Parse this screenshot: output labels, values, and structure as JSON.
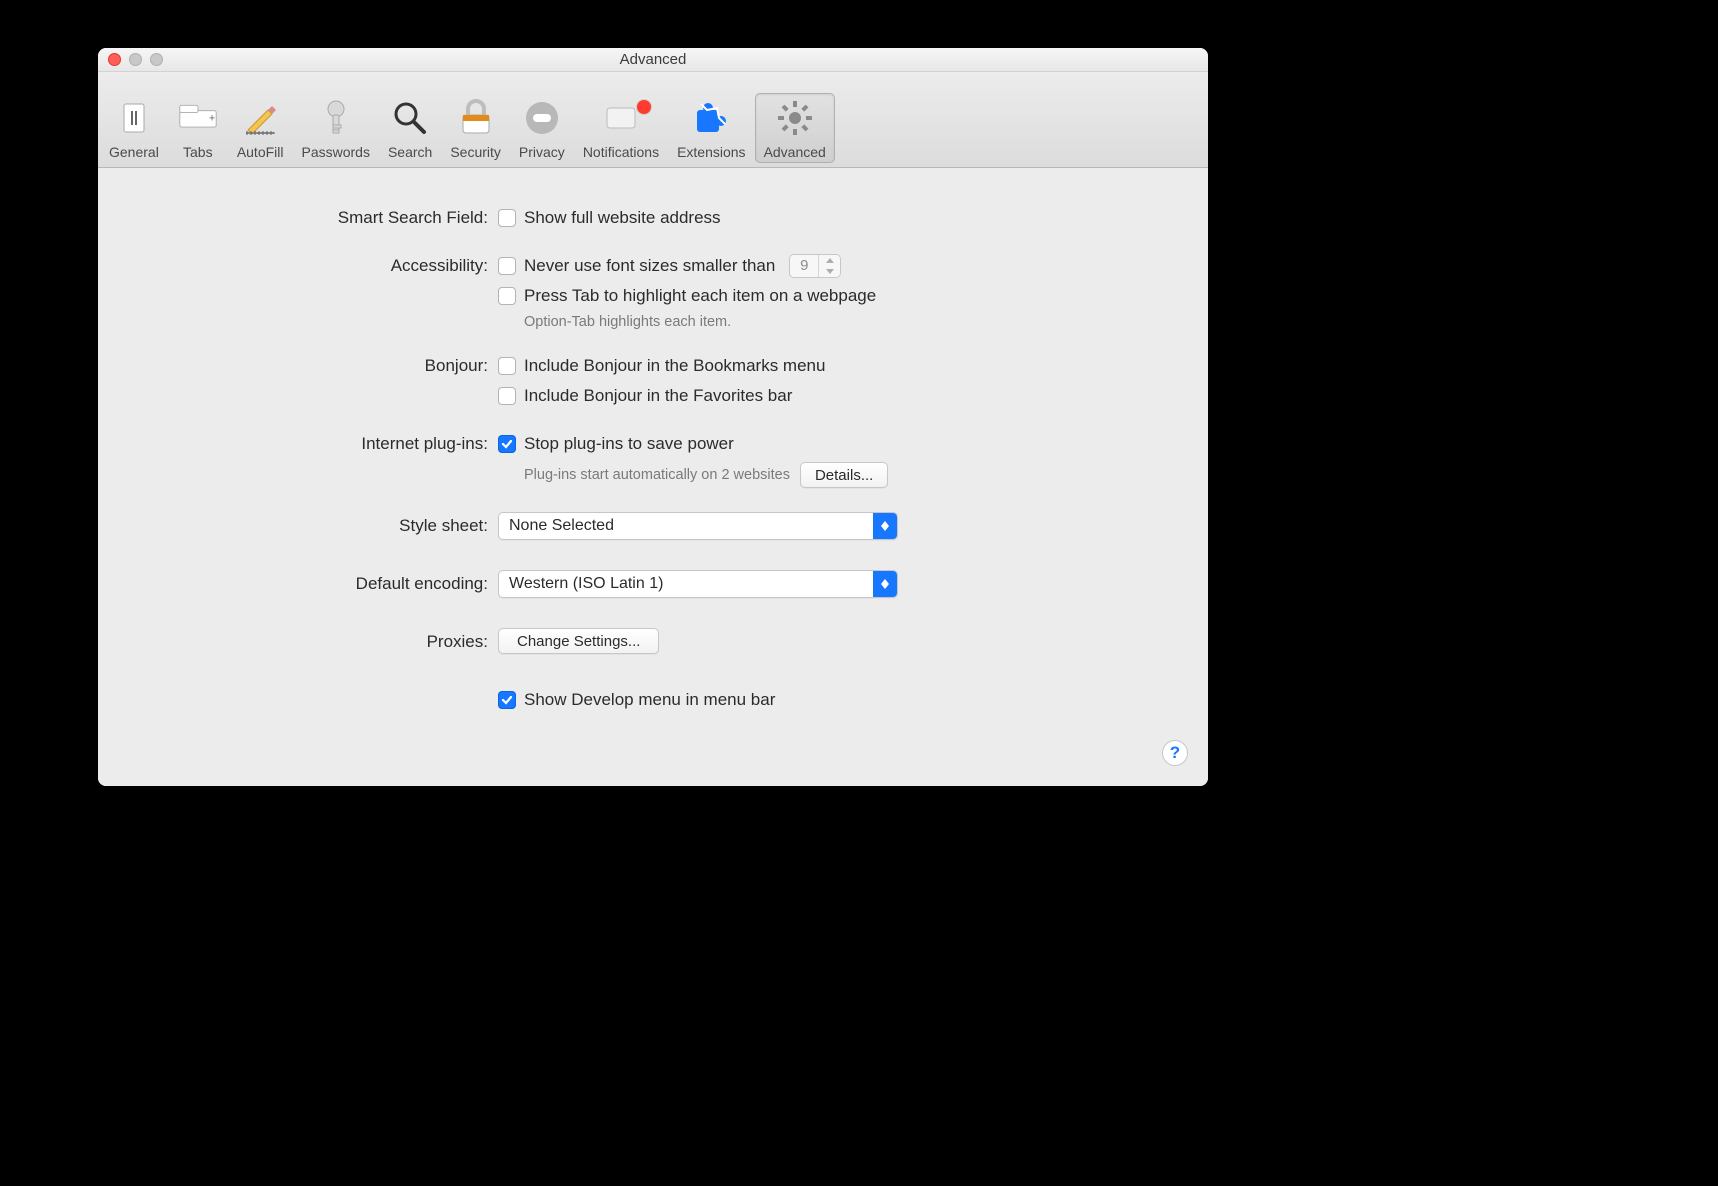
{
  "window": {
    "title": "Advanced"
  },
  "toolbar": {
    "items": [
      {
        "label": "General"
      },
      {
        "label": "Tabs"
      },
      {
        "label": "AutoFill"
      },
      {
        "label": "Passwords"
      },
      {
        "label": "Search"
      },
      {
        "label": "Security"
      },
      {
        "label": "Privacy"
      },
      {
        "label": "Notifications"
      },
      {
        "label": "Extensions"
      },
      {
        "label": "Advanced"
      }
    ]
  },
  "labels": {
    "smart_search": "Smart Search Field:",
    "accessibility": "Accessibility:",
    "bonjour": "Bonjour:",
    "plugins": "Internet plug-ins:",
    "stylesheet": "Style sheet:",
    "encoding": "Default encoding:",
    "proxies": "Proxies:"
  },
  "opts": {
    "show_full_address": "Show full website address",
    "never_font_smaller": "Never use font sizes smaller than",
    "font_size_value": "9",
    "press_tab": "Press Tab to highlight each item on a webpage",
    "press_tab_hint": "Option-Tab highlights each item.",
    "bonjour_bookmarks": "Include Bonjour in the Bookmarks menu",
    "bonjour_favorites": "Include Bonjour in the Favorites bar",
    "stop_plugins": "Stop plug-ins to save power",
    "plugins_hint": "Plug-ins start automatically on 2 websites",
    "details_btn": "Details...",
    "stylesheet_value": "None Selected",
    "encoding_value": "Western (ISO Latin 1)",
    "proxies_btn": "Change Settings...",
    "develop_menu": "Show Develop menu in menu bar"
  },
  "help": "?"
}
